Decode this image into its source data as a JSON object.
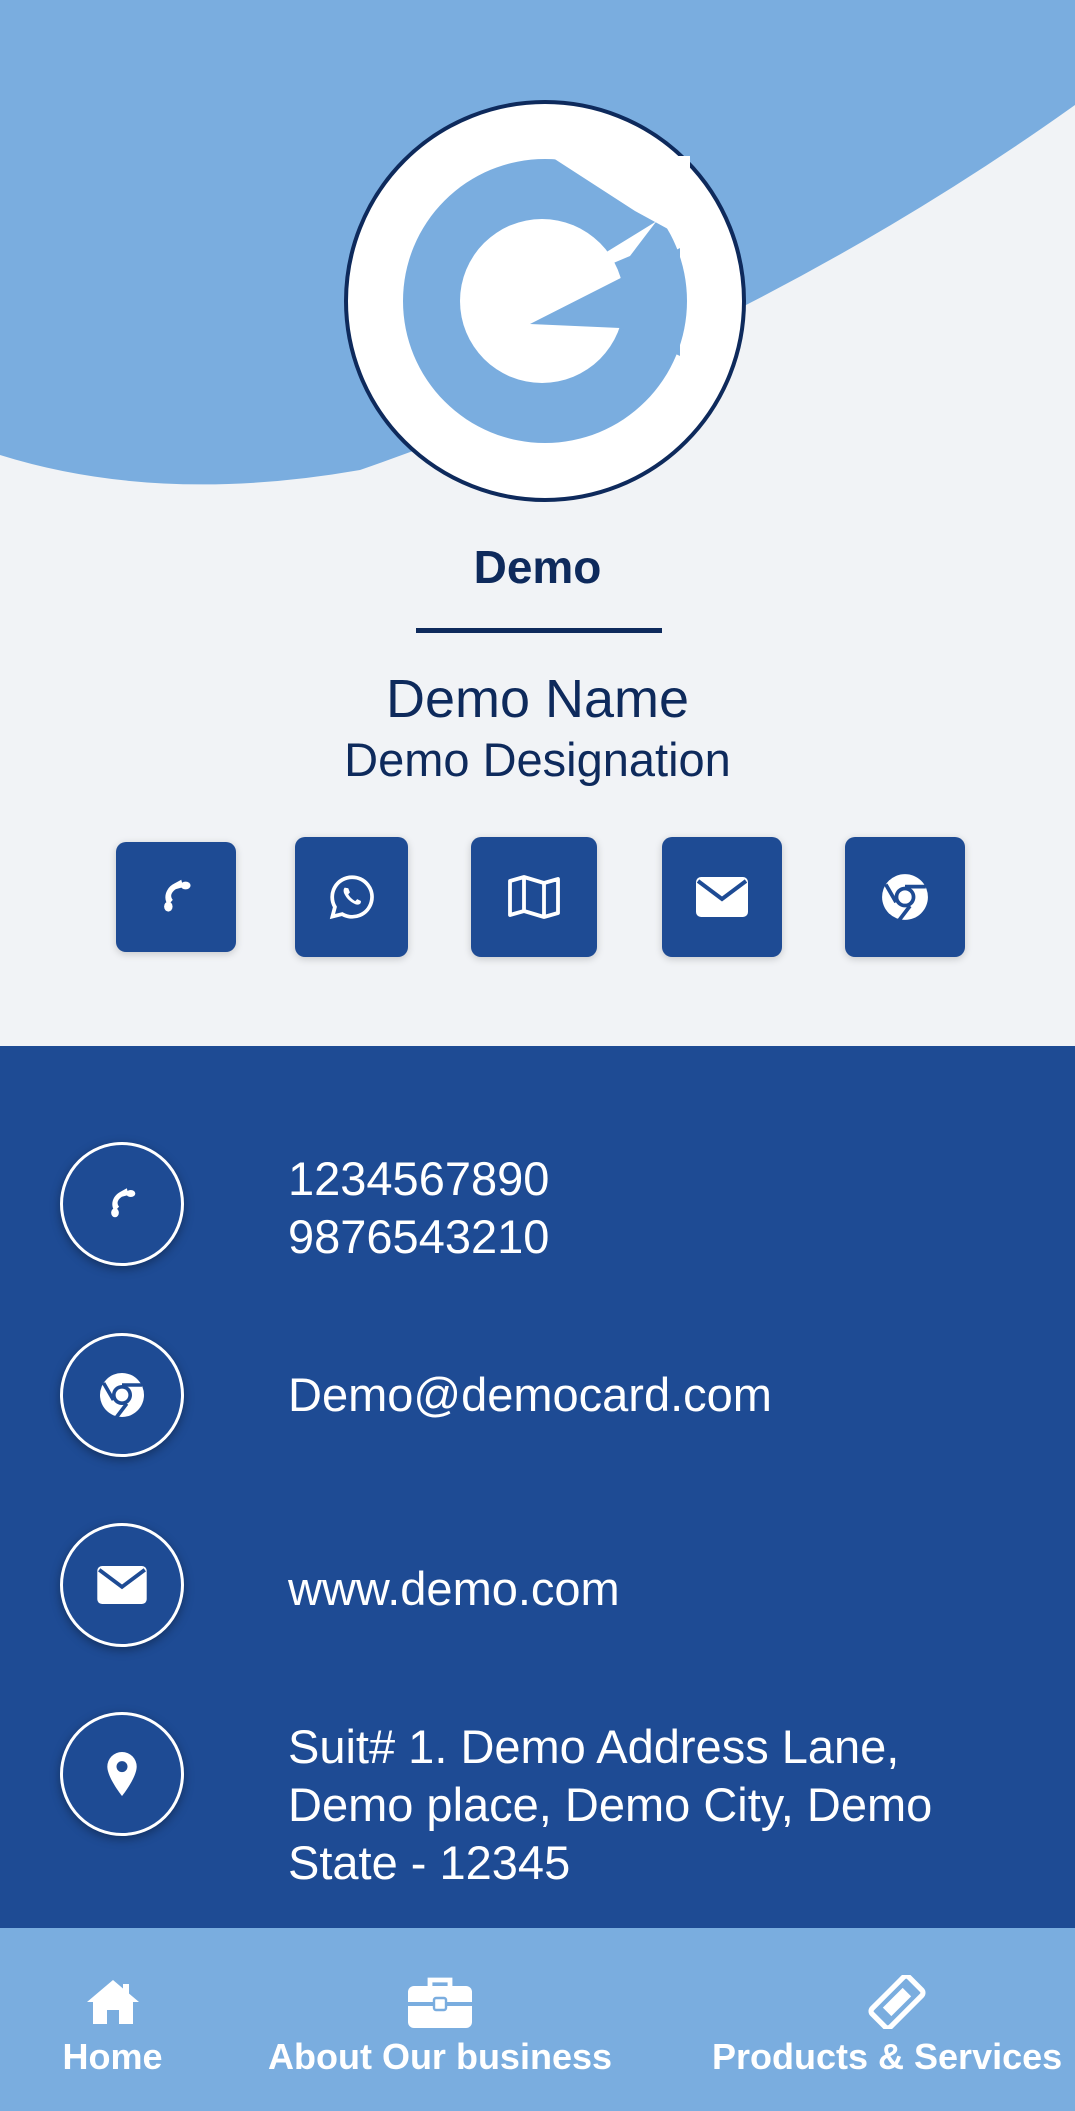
{
  "header": {
    "company_name": "Demo",
    "person_name": "Demo Name",
    "designation": "Demo Designation"
  },
  "quick_actions": [
    {
      "icon": "phone-icon"
    },
    {
      "icon": "whatsapp-icon"
    },
    {
      "icon": "map-icon"
    },
    {
      "icon": "envelope-icon"
    },
    {
      "icon": "chrome-icon"
    }
  ],
  "contacts": {
    "phone_1": "1234567890",
    "phone_2": "9876543210",
    "email": "Demo@democard.com",
    "website": "www.demo.com",
    "address_line_1": "Suit# 1. Demo Address Lane,",
    "address_line_2": "Demo place, Demo City, Demo",
    "address_line_3": "State - 12345"
  },
  "nav": {
    "home": "Home",
    "about": "About Our business",
    "products": "Products & Services"
  },
  "colors": {
    "primary": "#1e4b94",
    "dark": "#0e2a5c",
    "light_blue": "#7aaddf",
    "background": "#f1f3f6"
  }
}
